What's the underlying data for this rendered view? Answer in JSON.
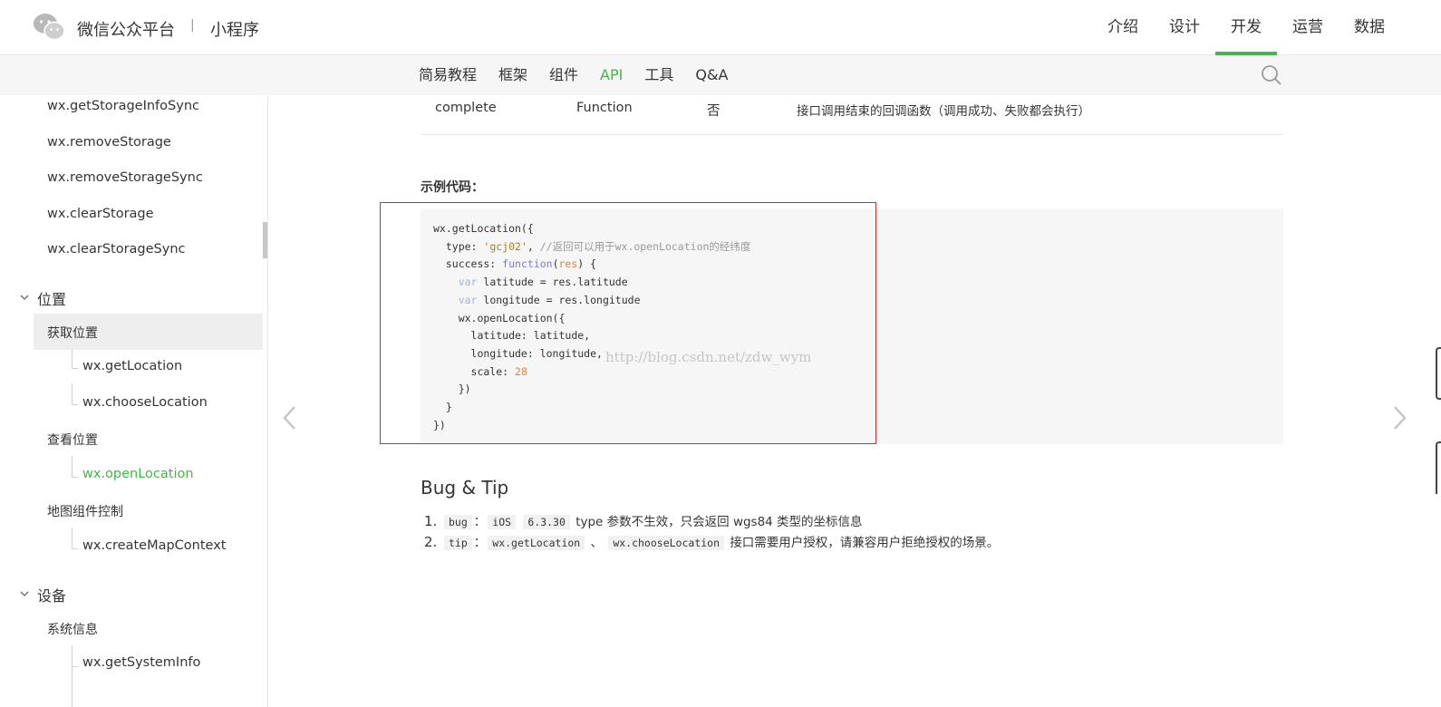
{
  "header": {
    "brand": "微信公众平台",
    "separator": "|",
    "product": "小程序",
    "nav": [
      {
        "label": "介绍"
      },
      {
        "label": "设计"
      },
      {
        "label": "开发",
        "active": true
      },
      {
        "label": "运营"
      },
      {
        "label": "数据"
      }
    ]
  },
  "subnav": {
    "items": [
      {
        "label": "简易教程"
      },
      {
        "label": "框架"
      },
      {
        "label": "组件"
      },
      {
        "label": "API",
        "active": true
      },
      {
        "label": "工具"
      },
      {
        "label": "Q&A"
      }
    ],
    "search_icon": "search-icon"
  },
  "sidebar": {
    "storage_items": [
      "wx.getStorageInfoSync",
      "wx.removeStorage",
      "wx.removeStorageSync",
      "wx.clearStorage",
      "wx.clearStorageSync"
    ],
    "category_location": "位置",
    "get_location_section": "获取位置",
    "get_location_items": [
      "wx.getLocation",
      "wx.chooseLocation"
    ],
    "view_location_section": "查看位置",
    "view_location_items": [
      "wx.openLocation"
    ],
    "map_section": "地图组件控制",
    "map_items": [
      "wx.createMapContext"
    ],
    "category_device": "设备",
    "system_section": "系统信息",
    "system_items": [
      "wx.getSystemInfo"
    ]
  },
  "main": {
    "param_row": {
      "name": "complete",
      "type": "Function",
      "required": "否",
      "desc": "接口调用结束的回调函数（调用成功、失败都会执行）"
    },
    "example_label": "示例代码：",
    "code": {
      "l1": "wx.getLocation({",
      "l2a": "  type: ",
      "l2b": "'gcj02'",
      "l2c": ", ",
      "l2d": "//返回可以用于wx.openLocation的经纬度",
      "l3a": "  success: ",
      "l3b": "function",
      "l3c": "(",
      "l3d": "res",
      "l3e": ") {",
      "l4a": "    ",
      "l4b": "var",
      "l4c": " latitude = res.latitude",
      "l5a": "    ",
      "l5b": "var",
      "l5c": " longitude = res.longitude",
      "l6": "    wx.openLocation({",
      "l7": "      latitude: latitude,",
      "l8": "      longitude: longitude,",
      "l9a": "      scale: ",
      "l9b": "28",
      "l10": "    })",
      "l11": "  }",
      "l12": "})"
    },
    "watermark": "http://blog.csdn.net/zdw_wym",
    "bug_title": "Bug & Tip",
    "tips": [
      {
        "num": "1.",
        "tag1": "bug",
        "sep": "：",
        "tag2": "iOS",
        "tag3": "6.3.30",
        "text": "type 参数不生效，只会返回 wgs84 类型的坐标信息"
      },
      {
        "num": "2.",
        "tag1": "tip",
        "sep": "：",
        "tag2": "wx.getLocation",
        "mid": "、",
        "tag3": "wx.chooseLocation",
        "text": "接口需要用户授权，请兼容用户拒绝授权的场景。"
      }
    ],
    "colors": {
      "accent": "#44b549",
      "highlight_border": "#d9272e"
    }
  }
}
